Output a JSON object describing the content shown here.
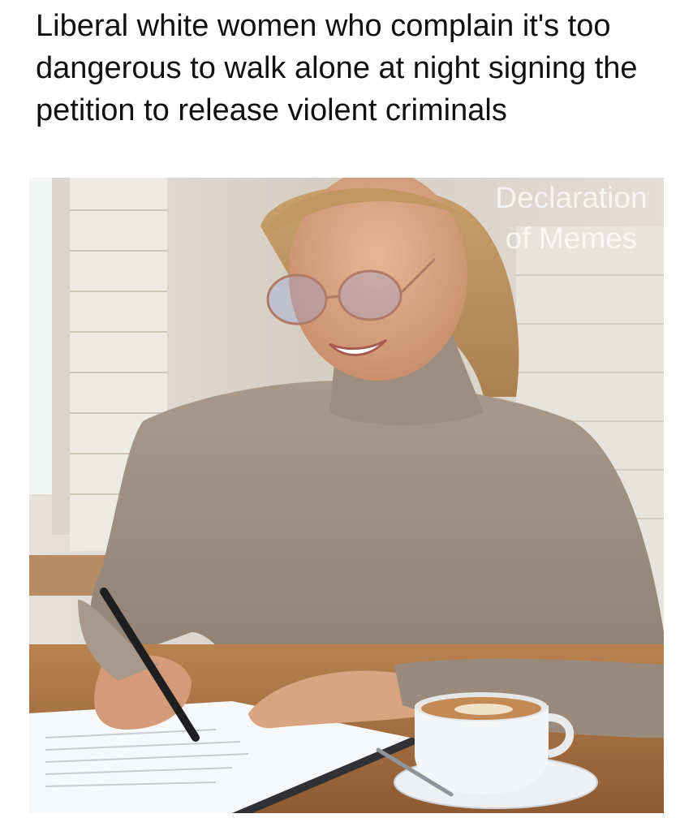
{
  "caption": {
    "text": "Liberal white women who complain it's too dangerous to walk alone at night signing the petition to release violent criminals"
  },
  "photo": {
    "watermark": {
      "line1": "Declaration",
      "line2": "of Memes"
    }
  }
}
